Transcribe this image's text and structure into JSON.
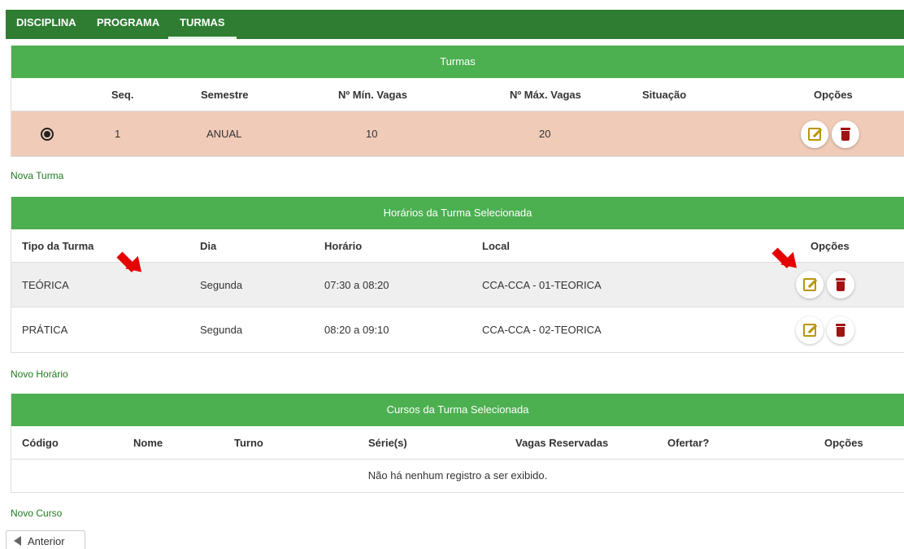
{
  "tabs": [
    "DISCIPLINA",
    "PROGRAMA",
    "TURMAS"
  ],
  "active_tab": "TURMAS",
  "turmas": {
    "title": "Turmas",
    "headers": [
      "Seq.",
      "Semestre",
      "Nº Mín. Vagas",
      "Nº Máx. Vagas",
      "Situação",
      "Opções"
    ],
    "rows": [
      {
        "seq": "1",
        "semestre": "ANUAL",
        "min": "10",
        "max": "20",
        "situacao": "",
        "selected": true
      }
    ],
    "new_link": "Nova Turma"
  },
  "horarios": {
    "title": "Horários da Turma Selecionada",
    "headers": [
      "Tipo da Turma",
      "Dia",
      "Horário",
      "Local",
      "Opções"
    ],
    "rows": [
      {
        "tipo": "TEÓRICA",
        "dia": "Segunda",
        "horario": "07:30 a 08:20",
        "local": "CCA-CCA - 01-TEORICA"
      },
      {
        "tipo": "PRÁTICA",
        "dia": "Segunda",
        "horario": "08:20 a 09:10",
        "local": "CCA-CCA - 02-TEORICA"
      }
    ],
    "new_link": "Novo Horário"
  },
  "cursos": {
    "title": "Cursos da Turma Selecionada",
    "headers": [
      "Código",
      "Nome",
      "Turno",
      "Série(s)",
      "Vagas Reservadas",
      "Ofertar?",
      "Opções"
    ],
    "empty_text": "Não há nenhum registro a ser exibido.",
    "new_link": "Novo Curso"
  },
  "prev_button": "Anterior",
  "colors": {
    "nav": "#2e7d32",
    "panel_header": "#4caf50",
    "selected_row": "#f0cbb8",
    "link": "#1e7b1e",
    "arrow": "#e60000",
    "edit_icon": "#b8960c",
    "delete_icon": "#a11212"
  },
  "icons": {
    "edit": "edit-icon",
    "delete": "trash-icon",
    "prev": "caret-left-icon"
  }
}
